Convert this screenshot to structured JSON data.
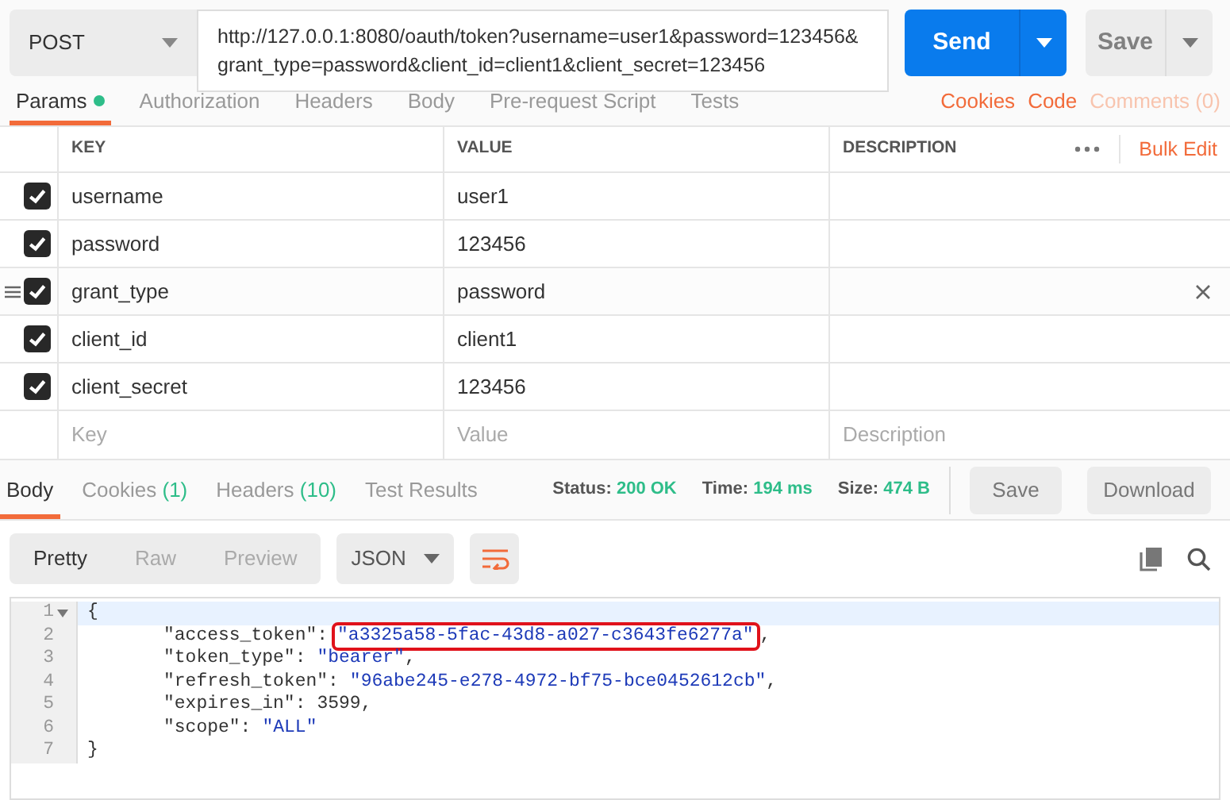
{
  "request": {
    "method": "POST",
    "url": "http://127.0.0.1:8080/oauth/token?username=user1&password=123456&grant_type=password&client_id=client1&client_secret=123456",
    "send": "Send",
    "save": "Save"
  },
  "request_tabs": [
    {
      "label": "Params",
      "selected": true,
      "dot": true
    },
    {
      "label": "Authorization",
      "selected": false,
      "dot": false
    },
    {
      "label": "Headers",
      "selected": false,
      "dot": false
    },
    {
      "label": "Body",
      "selected": false,
      "dot": false
    },
    {
      "label": "Pre-request Script",
      "selected": false,
      "dot": false
    },
    {
      "label": "Tests",
      "selected": false,
      "dot": false
    }
  ],
  "request_links": [
    {
      "label": "Cookies",
      "disabled": false
    },
    {
      "label": "Code",
      "disabled": false
    },
    {
      "label": "Comments (0)",
      "disabled": true
    }
  ],
  "params": {
    "columns": [
      "KEY",
      "VALUE",
      "DESCRIPTION"
    ],
    "bulk_edit": "Bulk Edit",
    "rows": [
      {
        "key": "username",
        "value": "user1",
        "checked": true,
        "hovered": false
      },
      {
        "key": "password",
        "value": "123456",
        "checked": true,
        "hovered": false
      },
      {
        "key": "grant_type",
        "value": "password",
        "checked": true,
        "hovered": true
      },
      {
        "key": "client_id",
        "value": "client1",
        "checked": true,
        "hovered": false
      },
      {
        "key": "client_secret",
        "value": "123456",
        "checked": true,
        "hovered": false
      }
    ],
    "new_row": {
      "key_placeholder": "Key",
      "value_placeholder": "Value",
      "description_placeholder": "Description"
    }
  },
  "response_tabs": [
    {
      "label": "Body",
      "selected": true
    },
    {
      "label": "Cookies",
      "count": "(1)",
      "selected": false
    },
    {
      "label": "Headers",
      "count": "(10)",
      "selected": false
    },
    {
      "label": "Test Results",
      "selected": false
    }
  ],
  "response_meta": [
    {
      "label": "Status:",
      "value": "200 OK"
    },
    {
      "label": "Time:",
      "value": "194 ms"
    },
    {
      "label": "Size:",
      "value": "474 B"
    }
  ],
  "response_buttons": [
    "Save",
    "Download"
  ],
  "view_modes": [
    {
      "label": "Pretty",
      "selected": true
    },
    {
      "label": "Raw",
      "selected": false
    },
    {
      "label": "Preview",
      "selected": false
    }
  ],
  "format": "JSON",
  "code_lines": [
    {
      "number": "1",
      "foldable": true,
      "active": true,
      "tokens": [
        {
          "kind": "punct",
          "text": "{"
        }
      ]
    },
    {
      "number": "2",
      "foldable": false,
      "active": false,
      "tokens": [
        {
          "kind": "key",
          "text": "\"access_token\":"
        },
        {
          "kind": "string",
          "text": "\"a3325a58-5fac-43d8-a027-c3643fe6277a\"",
          "highlighted": true
        },
        {
          "kind": "punct",
          "text": ","
        }
      ]
    },
    {
      "number": "3",
      "foldable": false,
      "active": false,
      "tokens": [
        {
          "kind": "key",
          "text": "\"token_type\":"
        },
        {
          "kind": "string",
          "text": "\"bearer\"",
          "highlighted": false
        },
        {
          "kind": "punct",
          "text": ","
        }
      ]
    },
    {
      "number": "4",
      "foldable": false,
      "active": false,
      "tokens": [
        {
          "kind": "key",
          "text": "\"refresh_token\":"
        },
        {
          "kind": "string",
          "text": "\"96abe245-e278-4972-bf75-bce0452612cb\"",
          "highlighted": false
        },
        {
          "kind": "punct",
          "text": ","
        }
      ]
    },
    {
      "number": "5",
      "foldable": false,
      "active": false,
      "tokens": [
        {
          "kind": "key",
          "text": "\"expires_in\":"
        },
        {
          "kind": "number",
          "text": "3599",
          "highlighted": false
        },
        {
          "kind": "punct",
          "text": ","
        }
      ]
    },
    {
      "number": "6",
      "foldable": false,
      "active": false,
      "tokens": [
        {
          "kind": "key",
          "text": "\"scope\":"
        },
        {
          "kind": "string",
          "text": "\"ALL\"",
          "highlighted": false
        }
      ]
    },
    {
      "number": "7",
      "foldable": false,
      "active": false,
      "tokens": [
        {
          "kind": "punct",
          "text": "}"
        }
      ]
    }
  ]
}
